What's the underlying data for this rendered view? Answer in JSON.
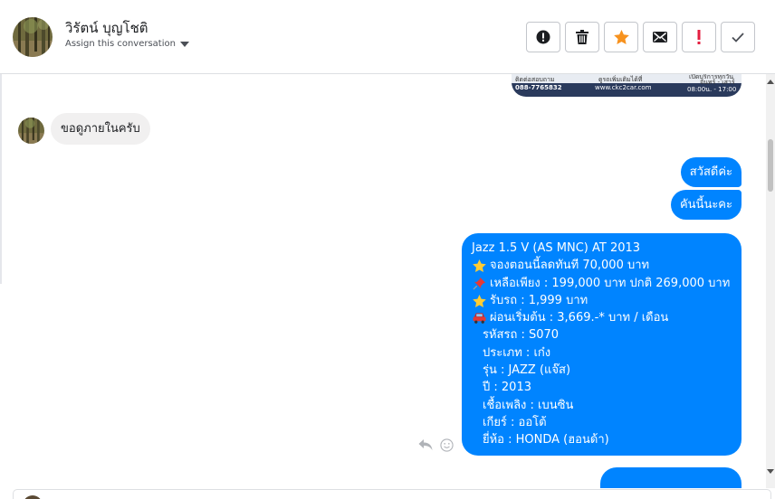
{
  "header": {
    "contact_name": "วิรัตน์ บุญโชติ",
    "assign_label": "Assign this conversation",
    "toolbar": [
      {
        "name": "spam-button",
        "icon": "alert-circle-icon"
      },
      {
        "name": "delete-button",
        "icon": "trash-icon"
      },
      {
        "name": "star-button",
        "icon": "star-icon"
      },
      {
        "name": "mark-unread-button",
        "icon": "envelope-icon"
      },
      {
        "name": "follow-up-button",
        "icon": "exclamation-icon"
      },
      {
        "name": "mark-done-button",
        "icon": "check-icon"
      }
    ]
  },
  "image_preview": {
    "left_text": "ติดต่อสอบถาม",
    "phone": "088-7765832",
    "mid_text": "ดูรถเพิ่มเติมได้ที่",
    "url": "www.ckc2car.com",
    "hours_title": "เปิดบริการทุกวัน",
    "days": "จันทร์ - เสาร์",
    "hours": "08:00น. - 17:00"
  },
  "messages": {
    "incoming_1": "ขอดูภายในครับ",
    "outgoing_1": "สวัสดีค่ะ",
    "outgoing_2": "คันนี้นะคะ",
    "details": {
      "title": "Jazz 1.5 V (AS MNC) AT 2013",
      "booking": "จองตอนนี้ลดทันที 70,000 บาท",
      "price": "เหลือเพียง : 199,000 บาท ปกติ 269,000 บาท",
      "pickup": "รับรถ : 1,999 บาท",
      "installment": "ผ่อนเริ่มต้น : 3,669.-* บาท / เดือน",
      "code": "รหัสรถ : S070",
      "type": "ประเภท : เก๋ง",
      "model": "รุ่น : JAZZ (แจ๊ส)",
      "year": "ปี : 2013",
      "fuel": "เชื้อเพลิง : เบนซิน",
      "gear": "เกียร์ : ออโต้",
      "brand": "ยี่ห้อ : HONDA (ฮอนด้า)"
    }
  },
  "colors": {
    "accent": "#0084ff",
    "incoming_bubble": "#f1f0f0",
    "star": "#f7921e",
    "alert": "#e41e3f"
  }
}
